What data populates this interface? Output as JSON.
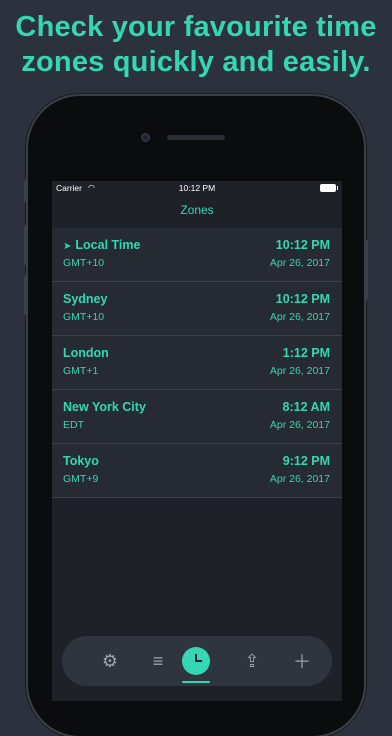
{
  "headline": {
    "line1": "Check your favourite time",
    "line2": "zones quickly and easily."
  },
  "status_bar": {
    "carrier": "Carrier",
    "wifi_icon": "wifi-icon",
    "time": "10:12 PM",
    "battery_icon": "battery-icon"
  },
  "nav": {
    "title": "Zones"
  },
  "zones": [
    {
      "city": "Local Time",
      "offset": "GMT+10",
      "time": "10:12 PM",
      "date": "Apr 26, 2017",
      "icon": "location-arrow-icon"
    },
    {
      "city": "Sydney",
      "offset": "GMT+10",
      "time": "10:12 PM",
      "date": "Apr 26, 2017"
    },
    {
      "city": "London",
      "offset": "GMT+1",
      "time": "1:12 PM",
      "date": "Apr 26, 2017"
    },
    {
      "city": "New York City",
      "offset": "EDT",
      "time": "8:12 AM",
      "date": "Apr 26, 2017"
    },
    {
      "city": "Tokyo",
      "offset": "GMT+9",
      "time": "9:12 PM",
      "date": "Apr 26, 2017"
    }
  ],
  "tabbar": {
    "tabs": [
      {
        "icon": "gear-icon",
        "selected": false
      },
      {
        "icon": "list-icon",
        "selected": false
      },
      {
        "icon": "clock-icon",
        "selected": true
      },
      {
        "icon": "share-icon",
        "selected": false
      },
      {
        "icon": "plus-icon",
        "selected": false
      }
    ]
  },
  "colors": {
    "accent": "#35d6b4",
    "background": "#2b323e",
    "screen": "#1e2228",
    "row": "#262b33"
  }
}
